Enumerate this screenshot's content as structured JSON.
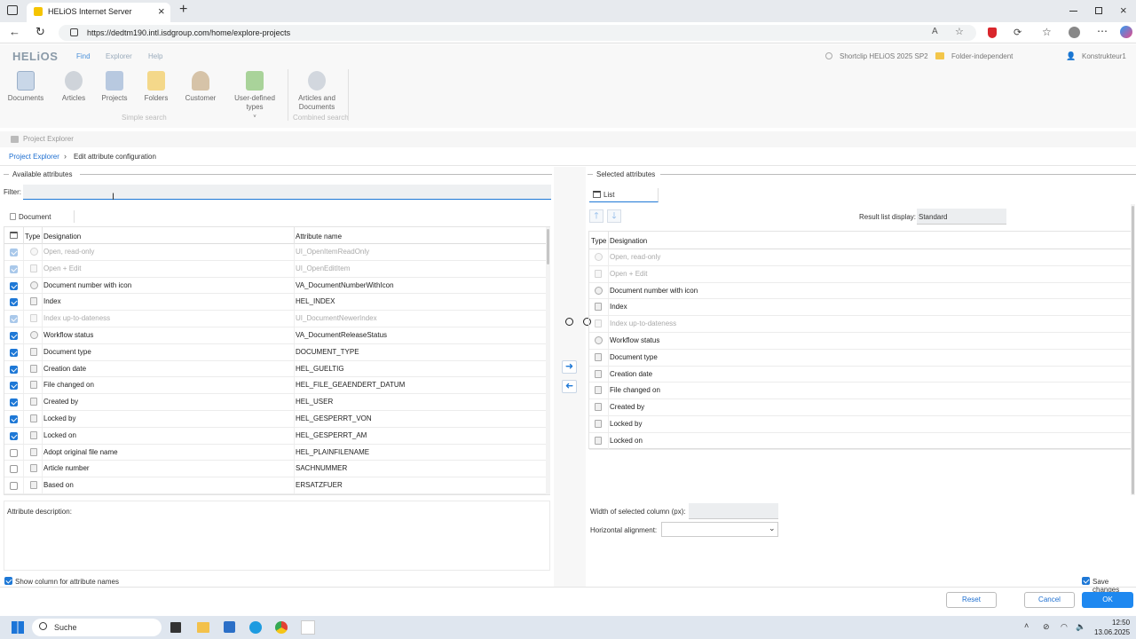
{
  "browser": {
    "tab_title": "HELiOS Internet Server",
    "url": "https://dedtm190.intl.isdgroup.com/home/explore-projects",
    "new_tab_glyph": "+",
    "close_glyph": "×"
  },
  "app": {
    "logo": "HELiOS",
    "nav": [
      "Find",
      "Explorer",
      "Help"
    ],
    "shortclip": "Shortclip HELiOS 2025 SP2",
    "folder_scope": "Folder-independent",
    "user": "Konstrukteur1",
    "ribbon": {
      "simple_search": [
        "Documents",
        "Articles",
        "Projects",
        "Folders",
        "Customer",
        "User-defined types"
      ],
      "simple_search_label": "Simple search",
      "combined_search": [
        "Articles and Documents"
      ],
      "combined_search_label": "Combined search"
    }
  },
  "project_explorer_title": "Project Explorer",
  "breadcrumb": {
    "root": "Project Explorer",
    "current": "Edit attribute configuration"
  },
  "available": {
    "title": "Available attributes",
    "filter_label": "Filter:",
    "filter_value": "",
    "tab": "Document",
    "headers": {
      "type": "Type",
      "designation": "Designation",
      "attr": "Attribute name"
    },
    "rows": [
      {
        "checked": true,
        "disabled": true,
        "icon": "gear",
        "designation": "Open, read-only",
        "attr": "UI_OpenItemReadOnly"
      },
      {
        "checked": true,
        "disabled": true,
        "icon": "doc",
        "designation": "Open + Edit",
        "attr": "UI_OpenEditItem"
      },
      {
        "checked": true,
        "disabled": false,
        "icon": "gear",
        "designation": "Document number with icon",
        "attr": "VA_DocumentNumberWithIcon"
      },
      {
        "checked": true,
        "disabled": false,
        "icon": "doc",
        "designation": "Index",
        "attr": "HEL_INDEX"
      },
      {
        "checked": true,
        "disabled": true,
        "icon": "doc",
        "designation": "Index up-to-dateness",
        "attr": "UI_DocumentNewerIndex"
      },
      {
        "checked": true,
        "disabled": false,
        "icon": "gear",
        "designation": "Workflow status",
        "attr": "VA_DocumentReleaseStatus"
      },
      {
        "checked": true,
        "disabled": false,
        "icon": "doc",
        "designation": "Document type",
        "attr": "DOCUMENT_TYPE"
      },
      {
        "checked": true,
        "disabled": false,
        "icon": "doc",
        "designation": "Creation date",
        "attr": "HEL_GUELTIG"
      },
      {
        "checked": true,
        "disabled": false,
        "icon": "doc",
        "designation": "File changed on",
        "attr": "HEL_FILE_GEAENDERT_DATUM"
      },
      {
        "checked": true,
        "disabled": false,
        "icon": "doc",
        "designation": "Created by",
        "attr": "HEL_USER"
      },
      {
        "checked": true,
        "disabled": false,
        "icon": "doc",
        "designation": "Locked by",
        "attr": "HEL_GESPERRT_VON"
      },
      {
        "checked": true,
        "disabled": false,
        "icon": "doc",
        "designation": "Locked on",
        "attr": "HEL_GESPERRT_AM"
      },
      {
        "checked": false,
        "disabled": false,
        "icon": "doc",
        "designation": "Adopt original file name",
        "attr": "HEL_PLAINFILENAME"
      },
      {
        "checked": false,
        "disabled": false,
        "icon": "doc",
        "designation": "Article number",
        "attr": "SACHNUMMER"
      },
      {
        "checked": false,
        "disabled": false,
        "icon": "doc",
        "designation": "Based on",
        "attr": "ERSATZFUER"
      }
    ],
    "description_label": "Attribute description:",
    "show_column_label": "Show column for attribute names"
  },
  "selected": {
    "title": "Selected attributes",
    "tab": "List",
    "result_list_label": "Result list display:",
    "result_list_value": "Standard",
    "headers": {
      "type": "Type",
      "designation": "Designation"
    },
    "rows": [
      {
        "disabled": true,
        "icon": "gear",
        "designation": "Open, read-only"
      },
      {
        "disabled": true,
        "icon": "doc",
        "designation": "Open + Edit"
      },
      {
        "disabled": false,
        "icon": "gear",
        "designation": "Document number with icon"
      },
      {
        "disabled": false,
        "icon": "doc",
        "designation": "Index"
      },
      {
        "disabled": true,
        "icon": "doc",
        "designation": "Index up-to-dateness"
      },
      {
        "disabled": false,
        "icon": "gear",
        "designation": "Workflow status"
      },
      {
        "disabled": false,
        "icon": "doc",
        "designation": "Document type"
      },
      {
        "disabled": false,
        "icon": "doc",
        "designation": "Creation date"
      },
      {
        "disabled": false,
        "icon": "doc",
        "designation": "File changed on"
      },
      {
        "disabled": false,
        "icon": "doc",
        "designation": "Created by"
      },
      {
        "disabled": false,
        "icon": "doc",
        "designation": "Locked by"
      },
      {
        "disabled": false,
        "icon": "doc",
        "designation": "Locked on"
      }
    ],
    "width_label": "Width of selected column (px):",
    "width_value": "",
    "align_label": "Horizontal alignment:",
    "align_value": ""
  },
  "footer": {
    "save_changes": "Save changes",
    "reset": "Reset",
    "cancel": "Cancel",
    "ok": "OK"
  },
  "taskbar": {
    "search": "Suche",
    "time": "12:50",
    "date": "13.06.2025"
  },
  "colors": {
    "accent": "#1e78d6",
    "ok_button": "#1e88f0"
  }
}
